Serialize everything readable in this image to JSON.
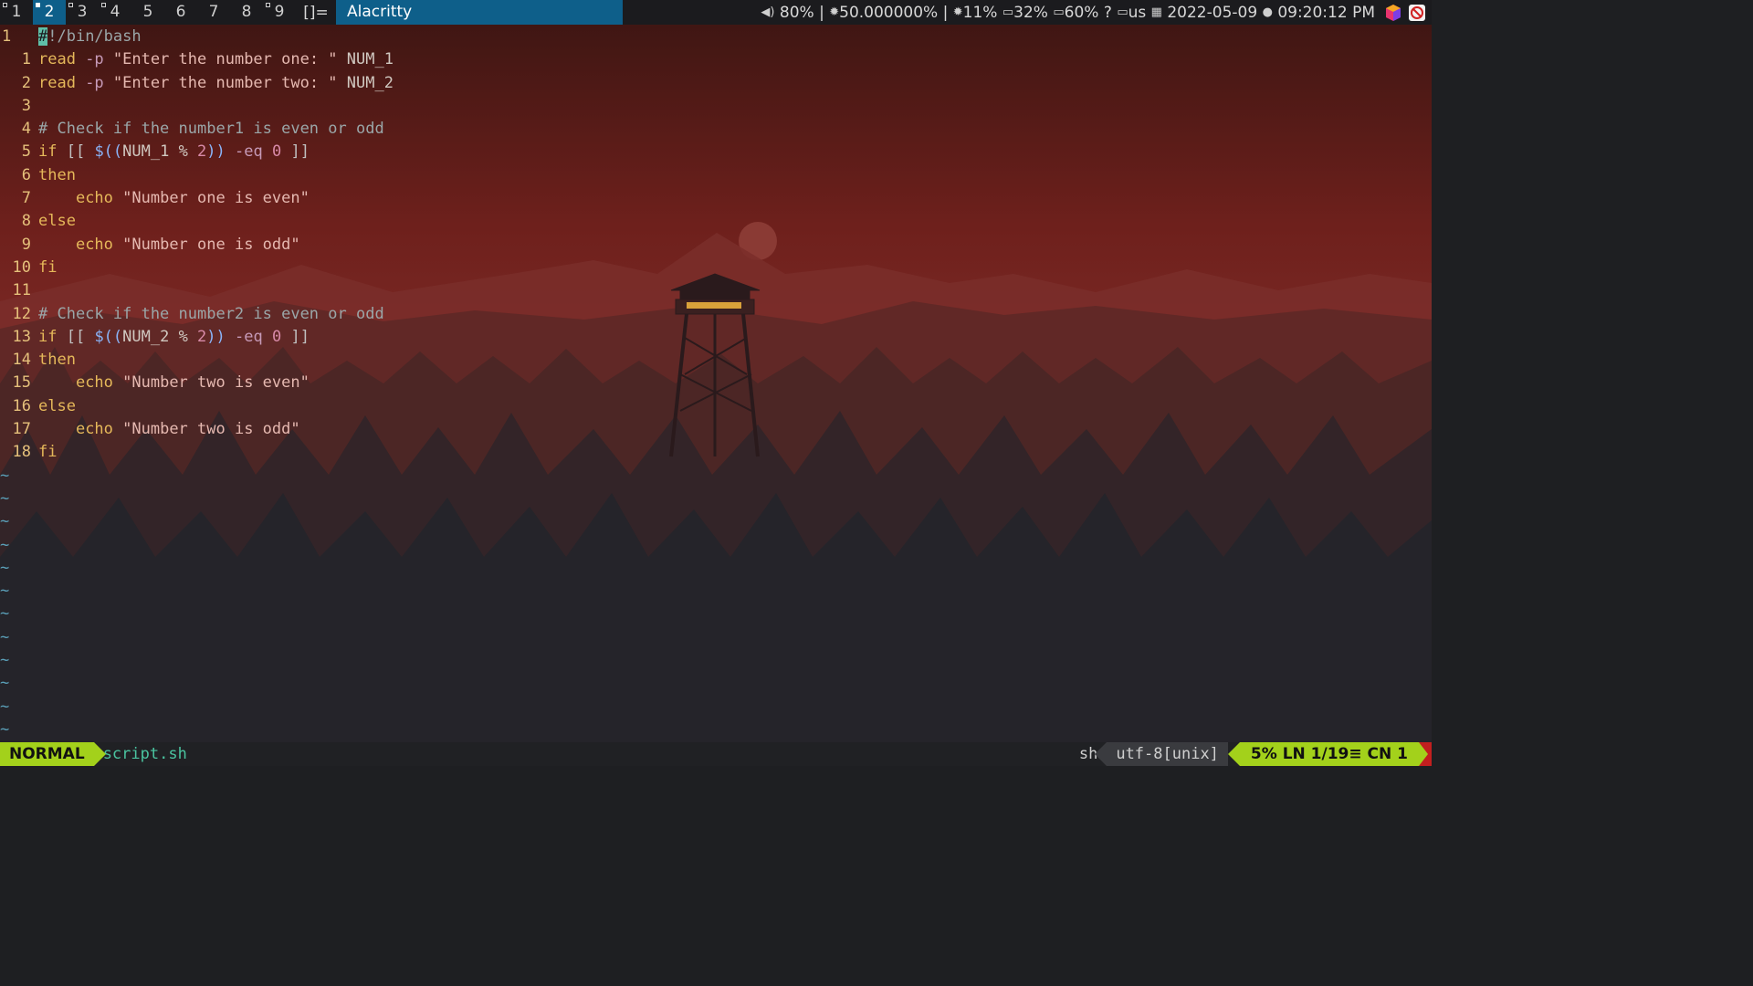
{
  "topbar": {
    "tags": [
      {
        "label": "1",
        "marker": "empty"
      },
      {
        "label": "2",
        "marker": "filled",
        "active": true
      },
      {
        "label": "3",
        "marker": "empty"
      },
      {
        "label": "4",
        "marker": "empty"
      },
      {
        "label": "5",
        "marker": "none"
      },
      {
        "label": "6",
        "marker": "none"
      },
      {
        "label": "7",
        "marker": "none"
      },
      {
        "label": "8",
        "marker": "none"
      },
      {
        "label": "9",
        "marker": "empty"
      }
    ],
    "layout_symbol": "[]=",
    "window_title": "Alacritty",
    "status": {
      "volume": " 80%",
      "brightness": "50.000000%",
      "cpu": "11%",
      "memory": "32%",
      "battery": "60%",
      "battery_state": "?",
      "keyboard": "us",
      "date": "2022-05-09",
      "time": "09:20:12 PM"
    },
    "tray_icons": [
      "cube-app-icon",
      "no-entry-icon"
    ]
  },
  "editor": {
    "cursor_line_label": "1",
    "lines": [
      {
        "n": "1",
        "current": true,
        "segments": [
          [
            "cursor",
            "#"
          ],
          [
            "cmt",
            "!/bin/bash"
          ]
        ]
      },
      {
        "n": "1",
        "segments": [
          [
            "cmd",
            "read"
          ],
          [
            "flag",
            " -p "
          ],
          [
            "str",
            "\"Enter the number one: \""
          ],
          [
            "var",
            " NUM_1"
          ]
        ]
      },
      {
        "n": "2",
        "segments": [
          [
            "cmd",
            "read"
          ],
          [
            "flag",
            " -p "
          ],
          [
            "str",
            "\"Enter the number two: \""
          ],
          [
            "var",
            " NUM_2"
          ]
        ]
      },
      {
        "n": "3",
        "segments": []
      },
      {
        "n": "4",
        "segments": [
          [
            "cmt",
            "# Check if the number1 is even or odd"
          ]
        ]
      },
      {
        "n": "5",
        "segments": [
          [
            "kw",
            "if"
          ],
          [
            "op",
            " [[ "
          ],
          [
            "dollar",
            "$(("
          ],
          [
            "var",
            "NUM_1 % "
          ],
          [
            "num",
            "2"
          ],
          [
            "dollar",
            "))"
          ],
          [
            "flag",
            " -eq "
          ],
          [
            "num",
            "0"
          ],
          [
            "op",
            " ]]"
          ]
        ]
      },
      {
        "n": "6",
        "segments": [
          [
            "kw",
            "then"
          ]
        ]
      },
      {
        "n": "7",
        "segments": [
          [
            "op",
            "    "
          ],
          [
            "cmd",
            "echo"
          ],
          [
            "str",
            " \"Number one is even\""
          ]
        ]
      },
      {
        "n": "8",
        "segments": [
          [
            "kw",
            "else"
          ]
        ]
      },
      {
        "n": "9",
        "segments": [
          [
            "op",
            "    "
          ],
          [
            "cmd",
            "echo"
          ],
          [
            "str",
            " \"Number one is odd\""
          ]
        ]
      },
      {
        "n": "10",
        "segments": [
          [
            "kw",
            "fi"
          ]
        ]
      },
      {
        "n": "11",
        "segments": []
      },
      {
        "n": "12",
        "segments": [
          [
            "cmt",
            "# Check if the number2 is even or odd"
          ]
        ]
      },
      {
        "n": "13",
        "segments": [
          [
            "kw",
            "if"
          ],
          [
            "op",
            " [[ "
          ],
          [
            "dollar",
            "$(("
          ],
          [
            "var",
            "NUM_2 % "
          ],
          [
            "num",
            "2"
          ],
          [
            "dollar",
            "))"
          ],
          [
            "flag",
            " -eq "
          ],
          [
            "num",
            "0"
          ],
          [
            "op",
            " ]]"
          ]
        ]
      },
      {
        "n": "14",
        "segments": [
          [
            "kw",
            "then"
          ]
        ]
      },
      {
        "n": "15",
        "segments": [
          [
            "op",
            "    "
          ],
          [
            "cmd",
            "echo"
          ],
          [
            "str",
            " \"Number two is even\""
          ]
        ]
      },
      {
        "n": "16",
        "segments": [
          [
            "kw",
            "else"
          ]
        ]
      },
      {
        "n": "17",
        "segments": [
          [
            "op",
            "    "
          ],
          [
            "cmd",
            "echo"
          ],
          [
            "str",
            " \"Number two is odd\""
          ]
        ]
      },
      {
        "n": "18",
        "segments": [
          [
            "kw",
            "fi"
          ]
        ]
      }
    ],
    "tilde_count": 12,
    "tilde_char": "~"
  },
  "statusline": {
    "mode": "NORMAL",
    "filename": "script.sh",
    "filetype": "sh",
    "encoding": "utf-8[unix]",
    "position": "5% LN 1/19≡ CN 1"
  },
  "colors": {
    "accent_blue": "#0e5f8a",
    "mode_green": "#a3d11b",
    "cap_red": "#c21f1f",
    "filename_teal": "#4ac4a0"
  }
}
